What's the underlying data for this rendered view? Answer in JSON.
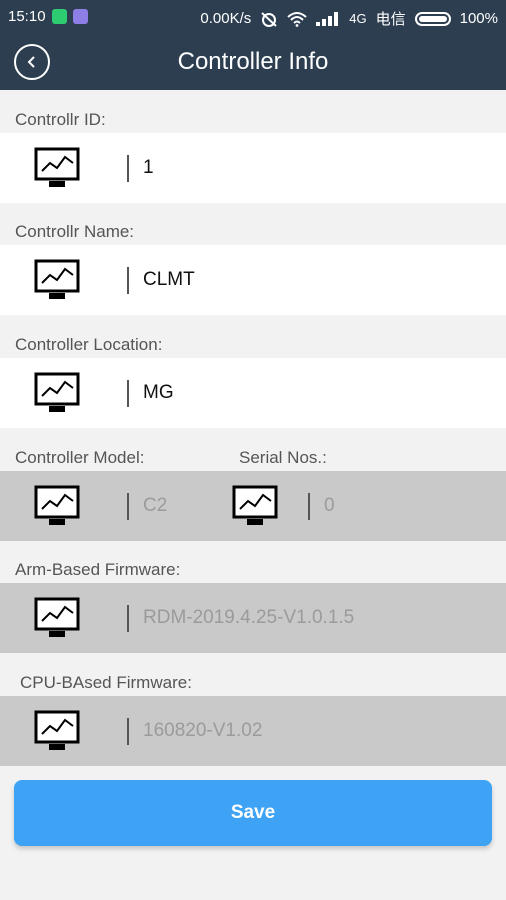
{
  "status_bar": {
    "time": "15:10",
    "net_speed": "0.00K/s",
    "carrier": "电信",
    "network_type": "4G",
    "battery": "100%"
  },
  "header": {
    "title": "Controller Info"
  },
  "fields": {
    "id": {
      "label": "Controllr ID:",
      "value": "1"
    },
    "name": {
      "label": "Controllr Name:",
      "value": "CLMT"
    },
    "location": {
      "label": "Controller Location:",
      "value": "MG"
    },
    "model": {
      "label": "Controller Model:",
      "value": "C2"
    },
    "serial": {
      "label": "Serial Nos.:",
      "value": "0"
    },
    "arm_firmware": {
      "label": "Arm-Based Firmware:",
      "value": "RDM-2019.4.25-V1.0.1.5"
    },
    "cpu_firmware": {
      "label": "CPU-BAsed Firmware:",
      "value": "160820-V1.02"
    }
  },
  "save_button": {
    "label": "Save"
  },
  "colors": {
    "header_bg": "#2c3e50",
    "accent": "#3ea3f4",
    "disabled_row": "#c9c9c9"
  },
  "icons": [
    "back-arrow-icon",
    "monitor-chart-icon",
    "wifi-icon",
    "signal-icon",
    "battery-icon"
  ]
}
